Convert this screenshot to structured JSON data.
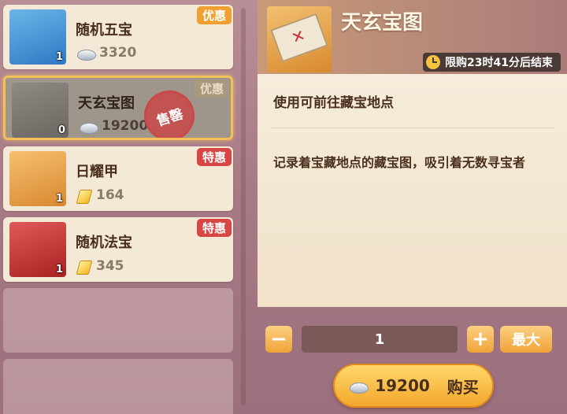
{
  "shop_list": {
    "items": [
      {
        "name": "随机五宝",
        "price": "3320",
        "currency_icon": "silver-ingot-icon",
        "qty": "1",
        "badge": "优惠",
        "badge_color": "#f0a030",
        "icon": "five-treasures-icon",
        "selected": false,
        "sold_out": false
      },
      {
        "name": "天玄宝图",
        "price": "19200",
        "currency_icon": "silver-ingot-icon",
        "qty": "0",
        "badge": "优惠",
        "badge_color": "#f0a030",
        "icon": "treasure-map-icon",
        "selected": true,
        "sold_out": true,
        "sold_out_label": "售罄"
      },
      {
        "name": "日耀甲",
        "price": "164",
        "currency_icon": "gold-ingot-icon",
        "qty": "1",
        "badge": "特惠",
        "badge_color": "#d84545",
        "icon": "sun-armor-icon",
        "selected": false,
        "sold_out": false
      },
      {
        "name": "随机法宝",
        "price": "345",
        "currency_icon": "gold-ingot-icon",
        "qty": "1",
        "badge": "特惠",
        "badge_color": "#d84545",
        "icon": "magic-treasure-icon",
        "selected": false,
        "sold_out": false
      }
    ]
  },
  "detail": {
    "title": "天玄宝图",
    "icon": "treasure-map-icon",
    "timer": "限购23时41分后结束",
    "usage": "使用可前往藏宝地点",
    "description": "记录着宝藏地点的藏宝图，吸引着无数寻宝者",
    "quantity": "1",
    "minus_label": "−",
    "plus_label": "+",
    "max_label": "最大",
    "buy_price": "19200",
    "buy_label": "购买"
  },
  "colors": {
    "accent_orange": "#f0a338",
    "badge_red": "#d84545",
    "selected_border": "#f2c05a",
    "text_brown": "#4a2e1c"
  }
}
